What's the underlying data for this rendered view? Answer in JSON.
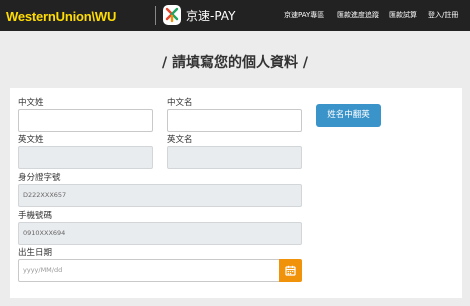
{
  "header": {
    "wu_logo": "WesternUnion\\WU",
    "jk_logo": "京速-PAY",
    "nav": [
      "京速PAY專區",
      "匯款進度追蹤",
      "匯款試算",
      "登入/註冊"
    ]
  },
  "page_title": "/ 請填寫您的個人資料 /",
  "form": {
    "chinese_surname_label": "中文姓",
    "chinese_surname_value": "",
    "chinese_given_label": "中文名",
    "chinese_given_value": "",
    "translate_button": "姓名中翻英",
    "english_surname_label": "英文姓",
    "english_surname_value": "",
    "english_given_label": "英文名",
    "english_given_value": "",
    "id_label": "身分證字號",
    "id_value": "D222XXX657",
    "phone_label": "手機號碼",
    "phone_value": "0910XXX694",
    "birth_label": "出生日期",
    "birth_placeholder": "yyyy/MM/dd"
  },
  "colors": {
    "header_bg": "#222222",
    "brand_yellow": "#ffdd00",
    "button_blue": "#3a93c9",
    "calendar_orange": "#f0930b",
    "page_bg": "#ececec",
    "disabled_field": "#e9ecef"
  },
  "icons": {
    "jk_logo": "jk-pay-logo-icon",
    "calendar": "calendar-icon"
  }
}
